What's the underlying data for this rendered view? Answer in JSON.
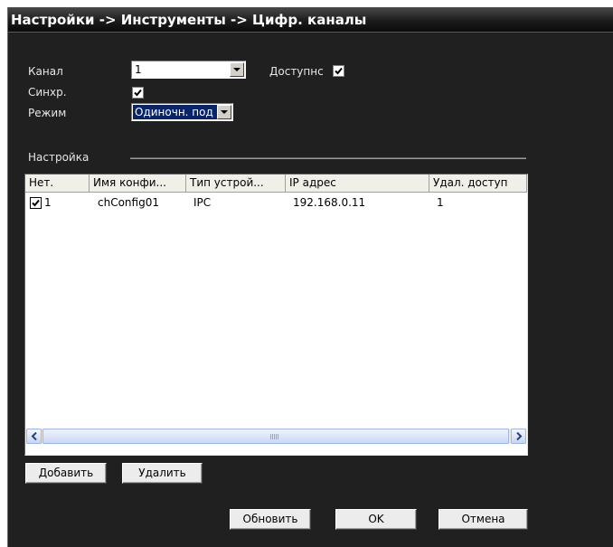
{
  "window": {
    "title": "Настройки -> Инструменты -> Цифр. каналы"
  },
  "form": {
    "channel_label": "Канал",
    "channel_value": "1",
    "available_label": "Доступнс",
    "available_checked": true,
    "sync_label": "Синхр.",
    "sync_checked": true,
    "mode_label": "Режим",
    "mode_value": "Одиночн. под",
    "settings_label": "Настройка"
  },
  "table": {
    "columns": [
      "Нет.",
      "Имя конфи...",
      "Тип устрой...",
      "IP адрес",
      "Удал. доступ"
    ],
    "rows": [
      {
        "checked": true,
        "num": "1",
        "name": "chConfig01",
        "type": "IPC",
        "ip": "192.168.0.11",
        "remote": "1"
      }
    ]
  },
  "buttons": {
    "add": "Добавить",
    "delete": "Удалить",
    "refresh": "Обновить",
    "ok": "OK",
    "cancel": "Отмена"
  },
  "colors": {
    "background": "#202020",
    "selection": "#0a246a",
    "scroll_accent": "#9fb5e2"
  },
  "icons": [
    "chevron-down-icon",
    "check-icon",
    "scroll-left-icon",
    "scroll-right-icon"
  ]
}
